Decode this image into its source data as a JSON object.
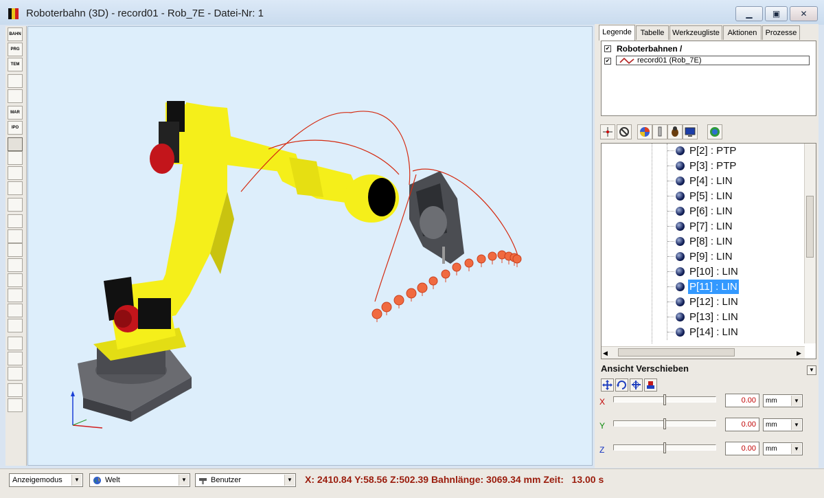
{
  "window": {
    "title": "Roboterbahn (3D)  - record01 - Rob_7E - Datei-Nr: 1",
    "minimize": "▁",
    "maximize": "▣",
    "close": "✕"
  },
  "left_toolbar": [
    {
      "name": "bahn-tool",
      "label": "BAHN"
    },
    {
      "name": "prg-tool",
      "label": "PRG"
    },
    {
      "name": "tem-tool",
      "label": "TEM"
    },
    {
      "name": "sphere-tool",
      "label": ""
    },
    {
      "name": "axes-tool",
      "label": ""
    },
    {
      "name": "mar-tool",
      "label": "MAR"
    },
    {
      "name": "ipo-tool",
      "label": "IPO"
    },
    {
      "name": "list-tool",
      "label": ""
    },
    {
      "name": "info-tool",
      "label": ""
    },
    {
      "name": "robot-settings-tool",
      "label": ""
    },
    {
      "name": "monitor-tool",
      "label": ""
    },
    {
      "name": "zoom-in-tool",
      "label": ""
    },
    {
      "name": "zoom-out-tool",
      "label": ""
    },
    {
      "name": "zoom-fit-tool",
      "label": ""
    },
    {
      "name": "view-front-tool",
      "label": ""
    },
    {
      "name": "view-side-tool",
      "label": ""
    },
    {
      "name": "view-top-tool",
      "label": ""
    },
    {
      "name": "view-left-tool",
      "label": ""
    },
    {
      "name": "view-right-tool",
      "label": ""
    },
    {
      "name": "view-iso-tool",
      "label": ""
    },
    {
      "name": "shade-tool",
      "label": ""
    },
    {
      "name": "paint-tool",
      "label": ""
    },
    {
      "name": "robot-tool",
      "label": ""
    },
    {
      "name": "tree-tool",
      "label": ""
    },
    {
      "name": "select-rect-tool",
      "label": ""
    }
  ],
  "tabs": [
    "Legende",
    "Tabelle",
    "Werkzeugliste",
    "Aktionen",
    "Prozesse"
  ],
  "legend": {
    "root_label": "Roboterbahnen /",
    "item_label": "record01 (Rob_7E)",
    "item_color": "#b22222"
  },
  "tree_items": [
    {
      "label": "P[2] : PTP",
      "selected": false
    },
    {
      "label": "P[3] : PTP",
      "selected": false
    },
    {
      "label": "P[4] : LIN",
      "selected": false
    },
    {
      "label": "P[5] : LIN",
      "selected": false
    },
    {
      "label": "P[6] : LIN",
      "selected": false
    },
    {
      "label": "P[7] : LIN",
      "selected": false
    },
    {
      "label": "P[8] : LIN",
      "selected": false
    },
    {
      "label": "P[9] : LIN",
      "selected": false
    },
    {
      "label": "P[10] : LIN",
      "selected": false
    },
    {
      "label": "P[11] : LIN",
      "selected": true
    },
    {
      "label": "P[12] : LIN",
      "selected": false
    },
    {
      "label": "P[13] : LIN",
      "selected": false
    },
    {
      "label": "P[14] : LIN",
      "selected": false
    }
  ],
  "view_panel": {
    "title": "Ansicht Verschieben",
    "axes": [
      {
        "axis": "X",
        "value": "0.00",
        "unit": "mm"
      },
      {
        "axis": "Y",
        "value": "0.00",
        "unit": "mm"
      },
      {
        "axis": "Z",
        "value": "0.00",
        "unit": "mm"
      }
    ]
  },
  "status": {
    "mode": "Anzeigemodus",
    "frame": "Welt",
    "user": "Benutzer",
    "readout": "X: 2410.84 Y:58.56 Z:502.39 Bahnlänge: 3069.34 mm Zeit:   13.00 s"
  },
  "colors": {
    "robot_yellow": "#f5ef1a",
    "path_red": "#d42a10",
    "point_orange": "#f06a40",
    "viewport_bg": "#ddeefb",
    "status_text": "#9a1c0c"
  }
}
